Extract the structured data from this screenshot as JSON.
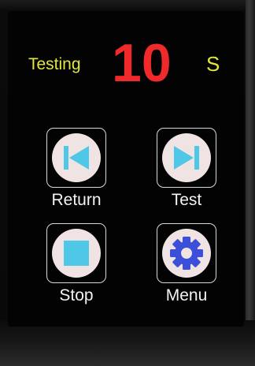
{
  "status": {
    "label": "Testing",
    "timer_value": "10",
    "timer_unit": "S"
  },
  "buttons": [
    {
      "label": "Return",
      "icon": "skip-back-icon"
    },
    {
      "label": "Test",
      "icon": "skip-forward-icon"
    },
    {
      "label": "Stop",
      "icon": "stop-icon"
    },
    {
      "label": "Menu",
      "icon": "gear-icon"
    }
  ],
  "colors": {
    "status_text": "#e3e63a",
    "timer": "#f02a2a",
    "icon_cyan": "#4fc8e8",
    "icon_blue": "#3b4fd8",
    "button_circle": "#f0e3e3"
  }
}
